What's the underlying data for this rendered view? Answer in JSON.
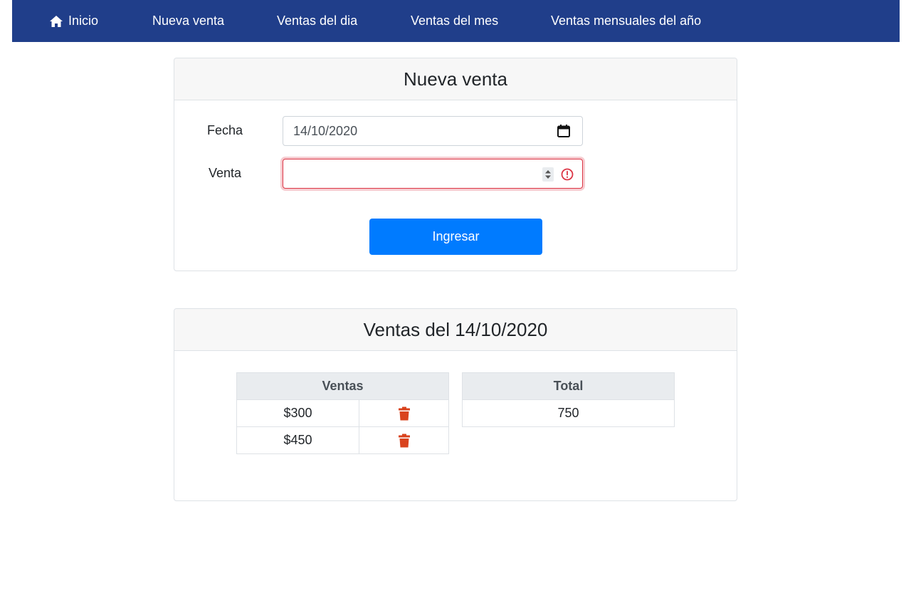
{
  "nav": {
    "home_label": "Inicio",
    "items": [
      "Nueva venta",
      "Ventas del dia",
      "Ventas del mes",
      "Ventas mensuales del año"
    ]
  },
  "form_card": {
    "title": "Nueva venta",
    "fecha_label": "Fecha",
    "fecha_value": "14/10/2020",
    "venta_label": "Venta",
    "venta_value": "",
    "submit_label": "Ingresar"
  },
  "sales_card": {
    "title": "Ventas del 14/10/2020",
    "ventas_header": "Ventas",
    "total_header": "Total",
    "rows": [
      {
        "amount": "$300"
      },
      {
        "amount": "$450"
      }
    ],
    "total_value": "750"
  },
  "colors": {
    "navbar": "#203e8a",
    "primary": "#007bff",
    "danger": "#dc3545",
    "trash": "#d9431e"
  }
}
